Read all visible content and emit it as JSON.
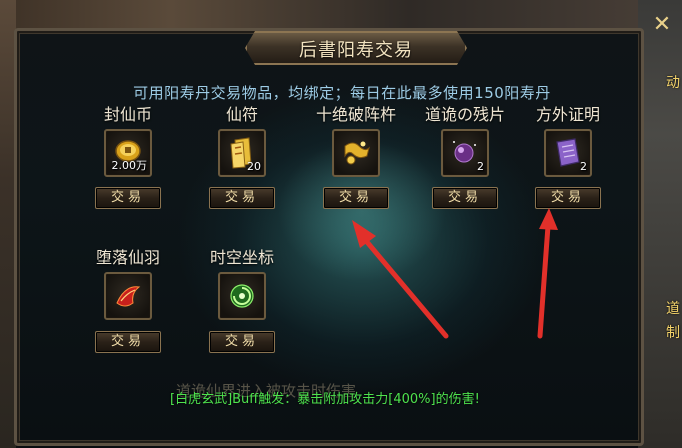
{
  "window": {
    "title": "后書阳寿交易"
  },
  "notice": "可用阳寿丹交易物品，均绑定；每日在此最多使用150阳寿丹",
  "items": [
    {
      "name": "封仙币",
      "count": "2.00万",
      "icon": "gold-coin-icon",
      "button": "交易"
    },
    {
      "name": "仙符",
      "count": "20",
      "icon": "talisman-icon",
      "button": "交易"
    },
    {
      "name": "十绝破阵杵",
      "count": "",
      "icon": "golden-pestle-icon",
      "button": "交易"
    },
    {
      "name": "道诡の残片",
      "count": "2",
      "icon": "purple-orb-icon",
      "button": "交易"
    },
    {
      "name": "方外证明",
      "count": "2",
      "icon": "purple-scroll-icon",
      "button": "交易"
    },
    {
      "name": "堕落仙羽",
      "count": "",
      "icon": "red-feather-icon",
      "button": "交易"
    },
    {
      "name": "时空坐标",
      "count": "",
      "icon": "green-vortex-icon",
      "button": "交易"
    }
  ],
  "broadcast": "[白虎玄武]Buff触发：暴击附加攻击力[400%]的伤害!",
  "broadcast_ghost": "道诡仙界进入被攻击时伤害",
  "colors": {
    "accent": "#f0dca8",
    "notice": "#9dcce6",
    "broadcast": "#4ee24e",
    "arrow": "#e2302a"
  }
}
